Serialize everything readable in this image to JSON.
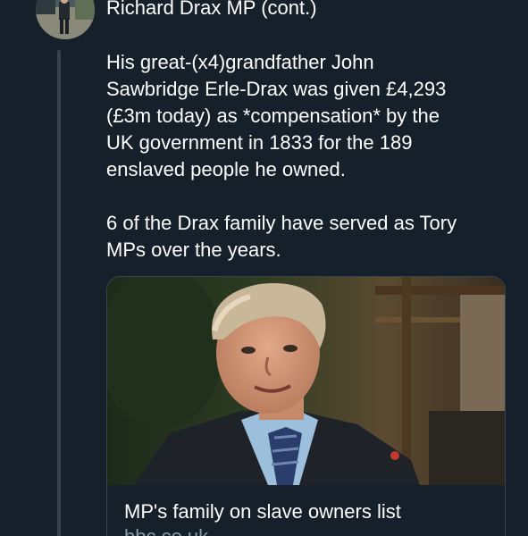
{
  "tweet": {
    "header": "Richard Drax MP (cont.)",
    "paragraph1_lines": [
      "His great-(x4)grandfather John",
      "Sawbridge Erle-Drax was given £4,293",
      "(£3m today) as *compensation* by the",
      "UK government in 1833 for the 189",
      "enslaved people he owned."
    ],
    "paragraph2_lines": [
      "6 of the Drax family have served as Tory",
      "MPs over the years."
    ]
  },
  "link_card": {
    "title": "MP's family on slave owners list",
    "domain": "bbc.co.uk"
  },
  "colors": {
    "background": "#15202b",
    "text": "#ffffff",
    "secondary_text": "#8899a6",
    "border": "#38444d"
  }
}
